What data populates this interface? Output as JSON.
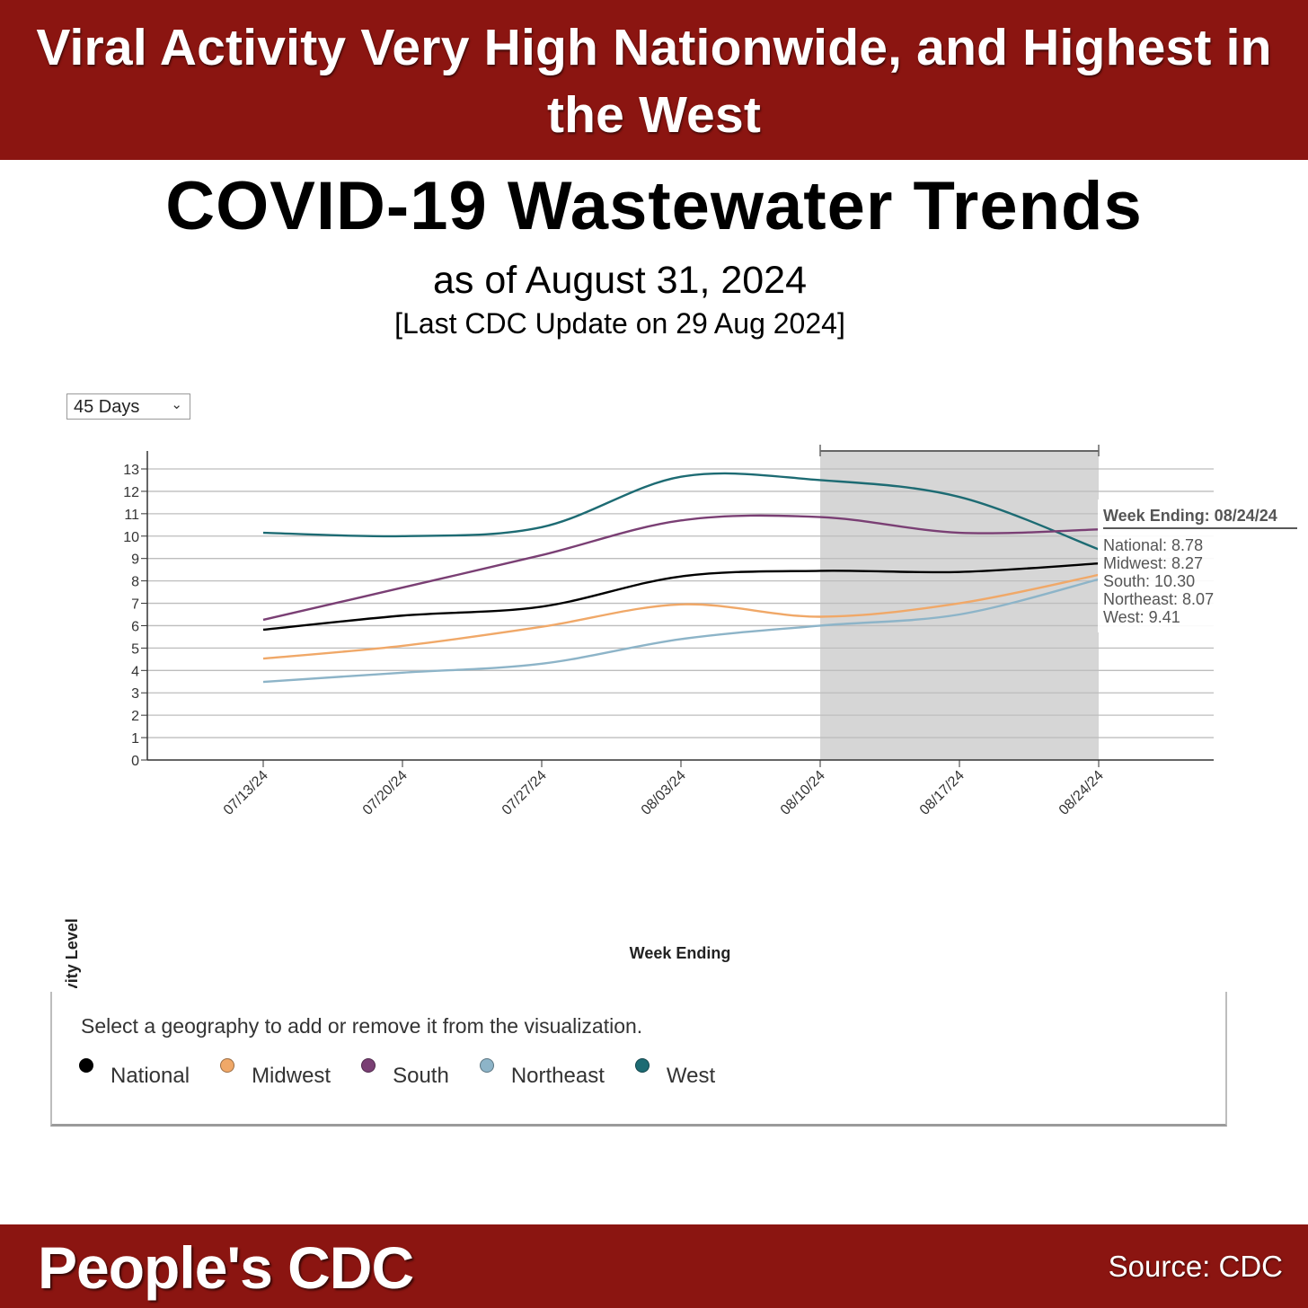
{
  "header": {
    "headline": "Viral Activity Very High Nationwide, and Highest in the West"
  },
  "title": "COVID-19 Wastewater Trends",
  "subtitle": "as of August 31, 2024",
  "update_note": "[Last CDC Update on 29 Aug 2024]",
  "range_select": {
    "selected": "45 Days"
  },
  "tooltip": {
    "title": "Week Ending: 08/24/24",
    "rows": [
      "National: 8.78",
      "Midwest: 8.27",
      "South: 10.30",
      "Northeast: 8.07",
      "West: 9.41"
    ]
  },
  "legend": {
    "instruction": "Select a geography to add or remove it from the visualization.",
    "items": [
      {
        "label": "National",
        "color": "#000000"
      },
      {
        "label": "Midwest",
        "color": "#f0a868"
      },
      {
        "label": "South",
        "color": "#7a3f74"
      },
      {
        "label": "Northeast",
        "color": "#8db4c8"
      },
      {
        "label": "West",
        "color": "#1d6b73"
      }
    ]
  },
  "footer": {
    "brand": "People's CDC",
    "source": "Source: CDC"
  },
  "chart_data": {
    "type": "line",
    "title": "COVID-19 Wastewater Trends",
    "xlabel": "Week Ending",
    "ylabel": "Wastewater Viral Activity Level",
    "ylim": [
      0,
      13
    ],
    "yticks": [
      "0",
      "1",
      "2",
      "3",
      "4",
      "5",
      "6",
      "7",
      "8",
      "9",
      "10",
      "11",
      "12",
      "13"
    ],
    "grid": true,
    "categories": [
      "07/13/24",
      "07/20/24",
      "07/27/24",
      "08/03/24",
      "08/10/24",
      "08/17/24",
      "08/24/24"
    ],
    "highlight_range": [
      "08/10/24",
      "08/24/24"
    ],
    "series": [
      {
        "name": "West",
        "color": "#1d6b73",
        "values": [
          10.15,
          10.0,
          10.4,
          12.65,
          12.5,
          11.75,
          9.41
        ]
      },
      {
        "name": "South",
        "color": "#7a3f74",
        "values": [
          6.26,
          7.7,
          9.15,
          10.7,
          10.85,
          10.15,
          10.3
        ]
      },
      {
        "name": "National",
        "color": "#000000",
        "values": [
          5.82,
          6.45,
          6.85,
          8.2,
          8.45,
          8.4,
          8.78
        ]
      },
      {
        "name": "Midwest",
        "color": "#f0a868",
        "values": [
          4.53,
          5.1,
          5.95,
          6.95,
          6.4,
          7.0,
          8.27
        ]
      },
      {
        "name": "Northeast",
        "color": "#8db4c8",
        "values": [
          3.49,
          3.9,
          4.3,
          5.4,
          6.0,
          6.5,
          8.07
        ]
      }
    ],
    "legend_position": "bottom"
  }
}
